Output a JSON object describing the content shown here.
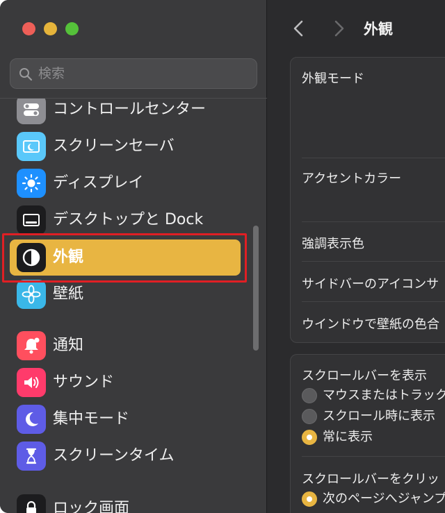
{
  "window": {
    "title": "外観"
  },
  "search": {
    "placeholder": "検索",
    "value": ""
  },
  "sidebar": {
    "items": [
      {
        "label": "コントロールセンター",
        "icon": "control-center-icon",
        "color": "#8e8e93"
      },
      {
        "label": "スクリーンセーバ",
        "icon": "screensaver-icon",
        "color": "#5ac8fa"
      },
      {
        "label": "ディスプレイ",
        "icon": "display-icon",
        "color": "#1e90ff"
      },
      {
        "label": "デスクトップと Dock",
        "icon": "desktop-dock-icon",
        "color": "#1c1c1e"
      },
      {
        "label": "外観",
        "icon": "appearance-icon",
        "color": "#1c1c1e",
        "selected": true
      },
      {
        "label": "壁紙",
        "icon": "wallpaper-icon",
        "color": "#3ab7e8"
      },
      {
        "label": "通知",
        "icon": "notifications-icon",
        "color": "#ff4f5e"
      },
      {
        "label": "サウンド",
        "icon": "sound-icon",
        "color": "#ff3b6b"
      },
      {
        "label": "集中モード",
        "icon": "focus-icon",
        "color": "#5e5ce6"
      },
      {
        "label": "スクリーンタイム",
        "icon": "screen-time-icon",
        "color": "#5e5ce6"
      },
      {
        "label": "ロック画面",
        "icon": "lock-screen-icon",
        "color": "#1c1c1e"
      }
    ]
  },
  "main": {
    "title": "外観",
    "rows": {
      "appearance_mode": "外観モード",
      "accent_color": "アクセントカラー",
      "highlight_color": "強調表示色",
      "sidebar_icon_size": "サイドバーのアイコンサ",
      "wallpaper_tint": "ウインドウで壁紙の色合"
    },
    "scrollbars": {
      "show_label": "スクロールバーを表示",
      "options": [
        {
          "label": "マウスまたはトラック",
          "selected": false
        },
        {
          "label": "スクロール時に表示",
          "selected": false
        },
        {
          "label": "常に表示",
          "selected": true
        }
      ],
      "click_label": "スクロールバーをクリッ",
      "click_options": [
        {
          "label": "次のページへジャンプ",
          "selected": true
        }
      ]
    }
  },
  "colors": {
    "accent": "#e8b542",
    "annotation_frame": "#e01f24",
    "sidebar_bg": "#3a3a3c",
    "main_bg": "#2b2b2d"
  }
}
